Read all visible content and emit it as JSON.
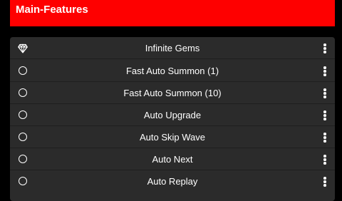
{
  "header": {
    "title": "Main-Features"
  },
  "colors": {
    "header_bg": "#fe0000",
    "panel_bg": "#2b2b2b",
    "page_bg": "#000000",
    "text": "#ffffff"
  },
  "features": [
    {
      "label": "Infinite Gems",
      "icon": "gem-icon"
    },
    {
      "label": "Fast Auto Summon (1)",
      "icon": "radio-unchecked-icon"
    },
    {
      "label": "Fast Auto Summon (10)",
      "icon": "radio-unchecked-icon"
    },
    {
      "label": "Auto Upgrade",
      "icon": "radio-unchecked-icon"
    },
    {
      "label": "Auto Skip Wave",
      "icon": "radio-unchecked-icon"
    },
    {
      "label": "Auto Next",
      "icon": "radio-unchecked-icon"
    },
    {
      "label": "Auto Replay",
      "icon": "radio-unchecked-icon"
    }
  ]
}
